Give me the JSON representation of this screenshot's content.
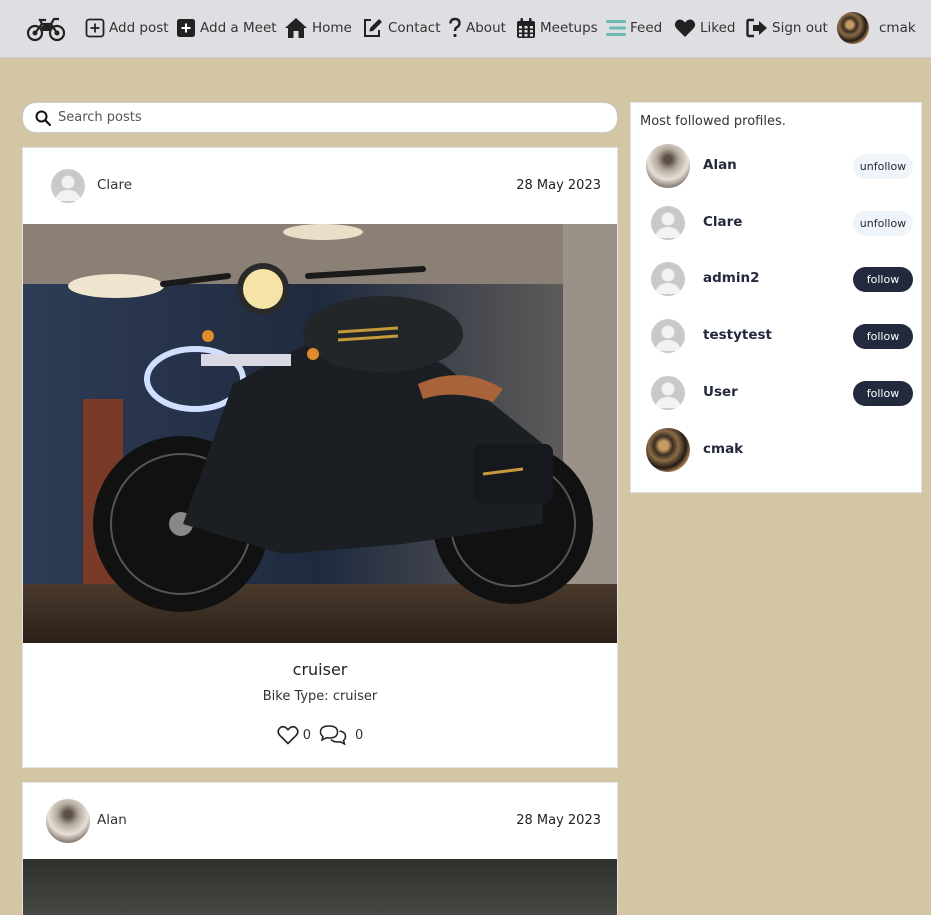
{
  "nav": {
    "brand_icon": "motorcycle-logo",
    "items": [
      {
        "label": "Add post",
        "icon": "plus-square-icon"
      },
      {
        "label": "Add a Meet",
        "icon": "plus-square-filled-icon"
      },
      {
        "label": "Home",
        "icon": "home-icon"
      },
      {
        "label": "Contact",
        "icon": "edit-icon"
      },
      {
        "label": "About",
        "icon": "question-icon"
      },
      {
        "label": "Meetups",
        "icon": "calendar-icon"
      },
      {
        "label": "Feed",
        "icon": "stream-icon"
      },
      {
        "label": "Liked",
        "icon": "heart-icon"
      },
      {
        "label": "Sign out",
        "icon": "sign-out-icon"
      }
    ],
    "user": {
      "name": "cmak"
    }
  },
  "search": {
    "placeholder": "Search posts",
    "value": ""
  },
  "posts": [
    {
      "author": "Clare",
      "date": "28 May 2023",
      "title": "cruiser",
      "subtitle": "Bike Type: cruiser",
      "likes": "0",
      "comments": "0"
    },
    {
      "author": "Alan",
      "date": "28 May 2023"
    }
  ],
  "sidebar": {
    "title": "Most followed profiles.",
    "profiles": [
      {
        "name": "Alan",
        "action": "unfollow"
      },
      {
        "name": "Clare",
        "action": "unfollow"
      },
      {
        "name": "admin2",
        "action": "follow"
      },
      {
        "name": "testytest",
        "action": "follow"
      },
      {
        "name": "User",
        "action": "follow"
      },
      {
        "name": "cmak",
        "action": ""
      }
    ]
  },
  "colors": {
    "page_background": "#d3c6a5",
    "navbar_background": "#dfdee2",
    "accent_dark": "#242a3d",
    "feed_icon": "#6bbbb0",
    "unfollow_background": "#eef4f8"
  }
}
